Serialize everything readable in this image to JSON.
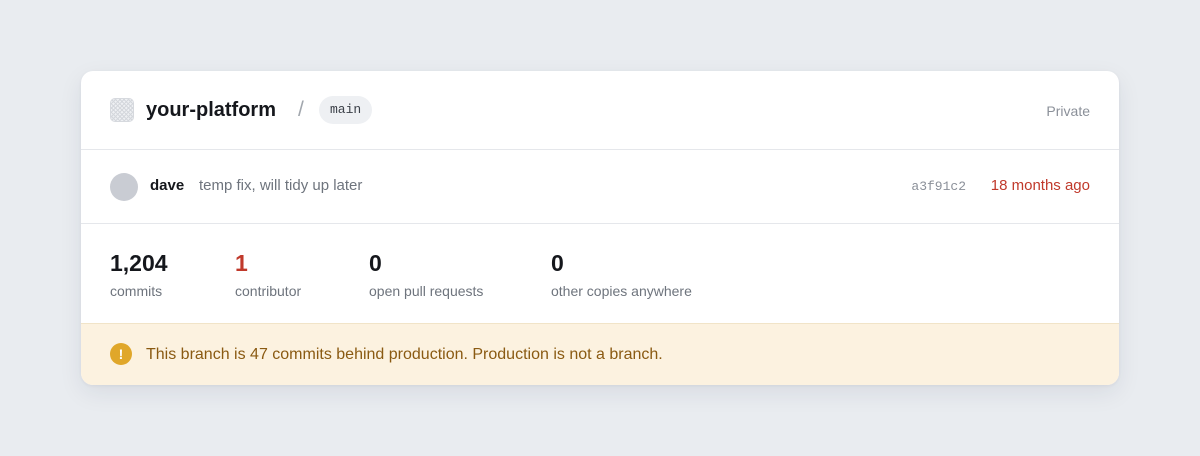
{
  "repo": {
    "name": "your-platform",
    "separator": "/",
    "branch": "main",
    "visibility": "Private",
    "icon": "repo-icon"
  },
  "commit": {
    "author": "dave",
    "message": "temp fix, will tidy up later",
    "sha": "a3f91c2",
    "age": "18 months ago",
    "age_color": "#c0392b"
  },
  "stats": [
    {
      "value": "1,204",
      "label": "commits"
    },
    {
      "value": "1",
      "label": "contributor"
    },
    {
      "value": "0",
      "label": "open pull requests"
    },
    {
      "value": "0",
      "label": "other copies anywhere"
    }
  ],
  "banner": {
    "icon": "!",
    "text": "This branch is 47 commits behind production. Production is not a branch.",
    "background": "#fcf2e0",
    "accent": "#e0a72a"
  }
}
